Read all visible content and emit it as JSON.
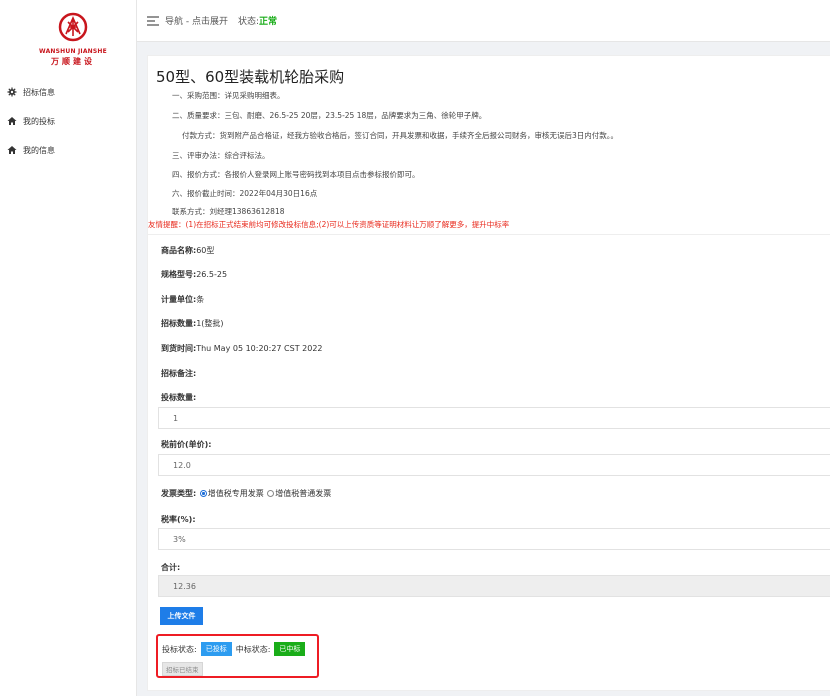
{
  "sidebar": {
    "logo": {
      "en": "WANSHUN JIANSHE",
      "cn": "万顺建设"
    },
    "items": [
      {
        "label": "招标信息",
        "icon": "gear-icon"
      },
      {
        "label": "我的投标",
        "icon": "home-icon"
      },
      {
        "label": "我的信息",
        "icon": "home-icon"
      }
    ]
  },
  "topbar": {
    "nav_text": "导航 - 点击展开",
    "status_label": "状态:",
    "status_value": "正常",
    "status_color": "#1aad19"
  },
  "project": {
    "title": "50型、60型装载机轮胎采购",
    "lines": [
      "一、采购范围：详见采购明细表。",
      "二、质量要求：三包、耐磨、26.5-25 20层，23.5-25 18层，品牌要求为三角、徐轮甲子牌。",
      "付款方式：货到附产品合格证，经我方验收合格后，签订合同，开具发票和收据，手续齐全后报公司财务，审核无误后3日内付款。。",
      "三、评审办法：综合评标法。",
      "四、报价方式：各报价人登录网上账号密码找到本项目点击参标报价即可。",
      "六、报价截止时间：2022年04月30日16点",
      "联系方式：刘经理13863612818"
    ],
    "notice": "友情提醒：(1)在招标正式结束前均可修改投标信息;(2)可以上传资质等证明材料让万顺了解更多，提升中标率"
  },
  "form": {
    "product_name_label": "商品名称:",
    "product_name_value": "60型",
    "spec_label": "规格型号:",
    "spec_value": "26.5-25",
    "unit_label": "计量单位:",
    "unit_value": "条",
    "bid_qty_label": "招标数量:",
    "bid_qty_value": "1(整批)",
    "delivery_label": "到货时间:",
    "delivery_value": "Thu May 05 10:20:27 CST 2022",
    "remark_label": "招标备注:",
    "tender_qty_label": "投标数量:",
    "tender_qty_value": "1",
    "price_label": "税前价(单价):",
    "price_value": "12.0",
    "invoice_label": "发票类型:",
    "invoice_option_1": "增值税专用发票",
    "invoice_option_2": "增值税普通发票",
    "tax_label": "税率(%):",
    "tax_value": "3%",
    "total_label": "合计:",
    "total_value": "12.36",
    "upload_label": "上传文件"
  },
  "status": {
    "bid_status_label": "投标状态:",
    "bid_status_value": "已投标",
    "win_status_label": "中标状态:",
    "win_status_value": "已中标",
    "ended_label": "招标已结束",
    "colors": {
      "bid": "#2d9cf0",
      "win": "#1aad19",
      "highlight_border": "#ee1c24"
    }
  }
}
